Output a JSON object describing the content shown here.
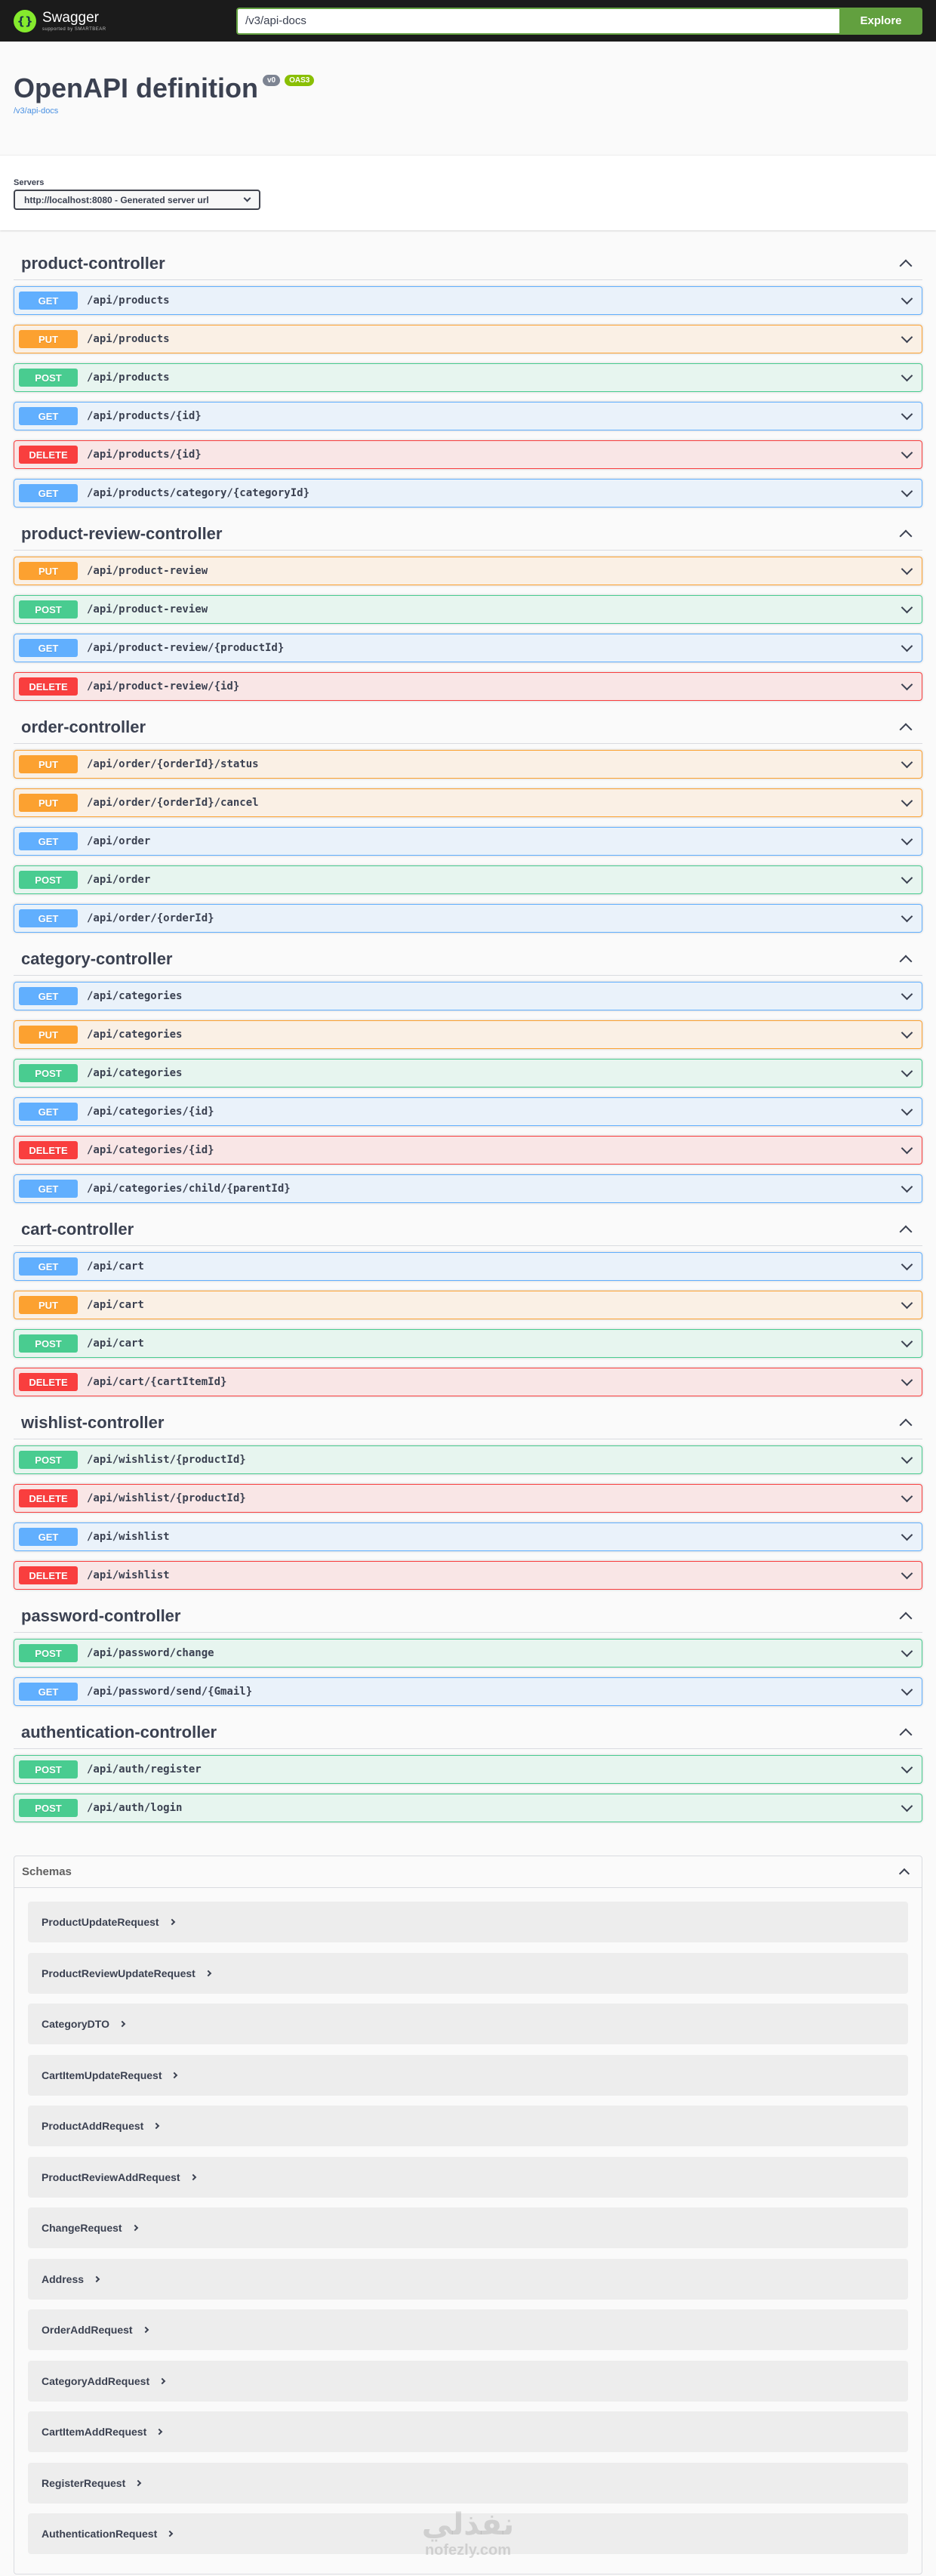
{
  "topbar": {
    "logo_title": "Swagger",
    "logo_subtitle": "supported by SMARTBEAR",
    "search_value": "/v3/api-docs",
    "explore_label": "Explore"
  },
  "info": {
    "title": "OpenAPI definition",
    "version_badge": "v0",
    "oas_badge": "OAS3",
    "url": "/v3/api-docs"
  },
  "servers": {
    "label": "Servers",
    "selected": "http://localhost:8080 - Generated server url"
  },
  "colors": {
    "get": "#61affe",
    "put": "#fca130",
    "post": "#49cc90",
    "delete": "#f93e3e",
    "explore": "#62a03f"
  },
  "tags": [
    {
      "name": "product-controller",
      "operations": [
        {
          "method": "GET",
          "path": "/api/products"
        },
        {
          "method": "PUT",
          "path": "/api/products"
        },
        {
          "method": "POST",
          "path": "/api/products"
        },
        {
          "method": "GET",
          "path": "/api/products/{id}"
        },
        {
          "method": "DELETE",
          "path": "/api/products/{id}"
        },
        {
          "method": "GET",
          "path": "/api/products/category/{categoryId}"
        }
      ]
    },
    {
      "name": "product-review-controller",
      "operations": [
        {
          "method": "PUT",
          "path": "/api/product-review"
        },
        {
          "method": "POST",
          "path": "/api/product-review"
        },
        {
          "method": "GET",
          "path": "/api/product-review/{productId}"
        },
        {
          "method": "DELETE",
          "path": "/api/product-review/{id}"
        }
      ]
    },
    {
      "name": "order-controller",
      "operations": [
        {
          "method": "PUT",
          "path": "/api/order/{orderId}/status"
        },
        {
          "method": "PUT",
          "path": "/api/order/{orderId}/cancel"
        },
        {
          "method": "GET",
          "path": "/api/order"
        },
        {
          "method": "POST",
          "path": "/api/order"
        },
        {
          "method": "GET",
          "path": "/api/order/{orderId}"
        }
      ]
    },
    {
      "name": "category-controller",
      "operations": [
        {
          "method": "GET",
          "path": "/api/categories"
        },
        {
          "method": "PUT",
          "path": "/api/categories"
        },
        {
          "method": "POST",
          "path": "/api/categories"
        },
        {
          "method": "GET",
          "path": "/api/categories/{id}"
        },
        {
          "method": "DELETE",
          "path": "/api/categories/{id}"
        },
        {
          "method": "GET",
          "path": "/api/categories/child/{parentId}"
        }
      ]
    },
    {
      "name": "cart-controller",
      "operations": [
        {
          "method": "GET",
          "path": "/api/cart"
        },
        {
          "method": "PUT",
          "path": "/api/cart"
        },
        {
          "method": "POST",
          "path": "/api/cart"
        },
        {
          "method": "DELETE",
          "path": "/api/cart/{cartItemId}"
        }
      ]
    },
    {
      "name": "wishlist-controller",
      "operations": [
        {
          "method": "POST",
          "path": "/api/wishlist/{productId}"
        },
        {
          "method": "DELETE",
          "path": "/api/wishlist/{productId}"
        },
        {
          "method": "GET",
          "path": "/api/wishlist"
        },
        {
          "method": "DELETE",
          "path": "/api/wishlist"
        }
      ]
    },
    {
      "name": "password-controller",
      "operations": [
        {
          "method": "POST",
          "path": "/api/password/change"
        },
        {
          "method": "GET",
          "path": "/api/password/send/{Gmail}"
        }
      ]
    },
    {
      "name": "authentication-controller",
      "operations": [
        {
          "method": "POST",
          "path": "/api/auth/register"
        },
        {
          "method": "POST",
          "path": "/api/auth/login"
        }
      ]
    }
  ],
  "schemas": {
    "title": "Schemas",
    "models": [
      "ProductUpdateRequest",
      "ProductReviewUpdateRequest",
      "CategoryDTO",
      "CartItemUpdateRequest",
      "ProductAddRequest",
      "ProductReviewAddRequest",
      "ChangeRequest",
      "Address",
      "OrderAddRequest",
      "CategoryAddRequest",
      "CartItemAddRequest",
      "RegisterRequest",
      "AuthenticationRequest"
    ]
  },
  "watermark": {
    "arabic": "نفذلي",
    "latin": "nofezly.com"
  }
}
